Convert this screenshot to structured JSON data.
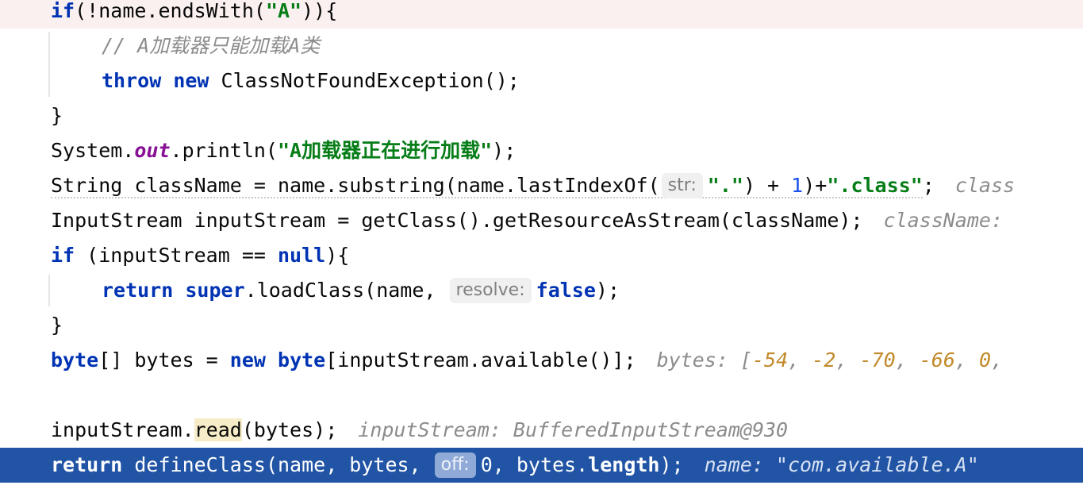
{
  "editor": {
    "lines": [
      {
        "id": "l1",
        "tokens": [
          "if",
          "(!name.endsWith(",
          "\"A\"",
          "))",
          "{"
        ]
      },
      {
        "id": "l2",
        "tokens": [
          "// A加载器只能加载A类"
        ]
      },
      {
        "id": "l3",
        "tokens": [
          "throw",
          "new",
          "ClassNotFoundException",
          "();"
        ]
      },
      {
        "id": "l4",
        "tokens": [
          "}"
        ]
      },
      {
        "id": "l5",
        "tokens": [
          "System.",
          "out",
          ".println(",
          "\"A加载器正在进行加载\"",
          ");"
        ]
      },
      {
        "id": "l6",
        "tokens": [
          "String className = name.substring(name.lastIndexOf(",
          "str:",
          "\".\"",
          ") + ",
          "1",
          ")+",
          "\".class\"",
          ";",
          "class"
        ]
      },
      {
        "id": "l7",
        "tokens": [
          "InputStream inputStream = getClass().getResourceAsStream(className);",
          "className:"
        ]
      },
      {
        "id": "l8",
        "tokens": [
          "if",
          "(inputStream == ",
          "null",
          ")",
          "{"
        ]
      },
      {
        "id": "l9",
        "tokens": [
          "return",
          "super",
          ".loadClass(name,",
          "resolve:",
          "false",
          ");"
        ]
      },
      {
        "id": "l10",
        "tokens": [
          "}"
        ]
      },
      {
        "id": "l11",
        "tokens": [
          "byte",
          "[] bytes = ",
          "new",
          "byte",
          "[inputStream.available()];",
          "bytes: [",
          "-54",
          ", ",
          "-2",
          ", ",
          "-70",
          ", ",
          "-66",
          ", ",
          "0",
          ","
        ]
      },
      {
        "id": "l12",
        "tokens": [
          ""
        ]
      },
      {
        "id": "l13",
        "tokens": [
          "inputStream.",
          "read",
          "(bytes);",
          "inputStream: BufferedInputStream@930"
        ]
      },
      {
        "id": "l14",
        "tokens": [
          "return",
          "defineClass(name, bytes,",
          "off:",
          "0, bytes.",
          "length",
          ");",
          "name: \"com.available.A\""
        ]
      }
    ]
  },
  "colors": {
    "keyword": "#0033b3",
    "string": "#067d17",
    "number": "#1750eb",
    "execution_line": "#2154a5",
    "current_line_top": "#fbf0f0"
  }
}
